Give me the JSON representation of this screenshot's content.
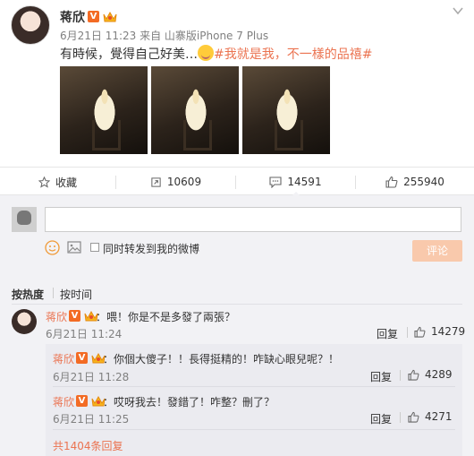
{
  "post": {
    "author": "蒋欣",
    "meta": "6月21日 11:23 来自 山寨版iPhone 7 Plus",
    "text_before": "有時候，覺得自己好美…",
    "hashtag": "#我就是我，不一樣的品禧#"
  },
  "actions": {
    "favorite_label": "收藏",
    "repost_count": "10609",
    "comment_count": "14591",
    "like_count": "255940"
  },
  "composer": {
    "input_value": "",
    "sync_label": "同时转发到我的微博",
    "submit_label": "评论"
  },
  "sort": {
    "hot_label": "按热度",
    "time_label": "按时间"
  },
  "comment": {
    "author": "蒋欣",
    "text": "：喂！你是不是多發了兩張？",
    "time": "6月21日 11:24",
    "reply_label": "回复",
    "likes": "14279"
  },
  "replies": [
    {
      "author": "蒋欣",
      "text": "：你個大傻子！！長得挺精的！咋缺心眼兒呢？！",
      "time": "6月21日 11:28",
      "reply_label": "回复",
      "likes": "4289"
    },
    {
      "author": "蒋欣",
      "text": "：哎呀我去！發錯了！咋整？刪了？",
      "time": "6月21日 11:25",
      "reply_label": "回复",
      "likes": "4271"
    }
  ],
  "more_replies": "共1404条回复",
  "colors": {
    "accent": "#eb7350",
    "submit_disabled": "#f9c9ac",
    "panel": "#f2f2f5"
  },
  "icons": [
    "verified-icon",
    "crown-icon",
    "chevron-down-icon",
    "star-icon",
    "repost-icon",
    "comment-icon",
    "thumbs-up-icon",
    "emoji-icon",
    "image-icon"
  ]
}
